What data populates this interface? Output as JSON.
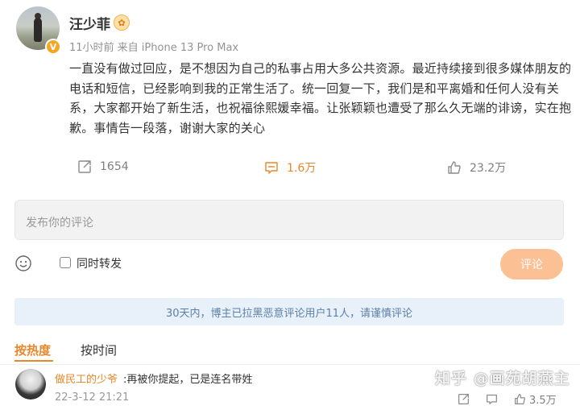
{
  "post": {
    "author": "汪少菲",
    "vip_badge": "✿",
    "meta": "11小时前 来自 iPhone 13 Pro Max",
    "text": "一直没有做过回应，是不想因为自己的私事占用大多公共资源。最近持续接到很多媒体朋友的电话和短信，已经影响到我的正常生活了。统一回复一下，我们是和平离婚和任何人没有关系，大家都开始了新生活，也祝福徐熙媛幸福。让张颖颖也遭受了那么久无端的诽谤，实在抱歉。事情告一段落，谢谢大家的关心"
  },
  "actions": {
    "repost_count": "1654",
    "comment_count": "1.6万",
    "like_count": "23.2万"
  },
  "comment_input": {
    "placeholder": "发布你的评论",
    "also_repost_label": "同时转发",
    "submit_label": "评论"
  },
  "notice": "30天内，博主已拉黑恶意评论用户11人，请谨慎评论",
  "tabs": {
    "hot": "按热度",
    "time": "按时间"
  },
  "comments": [
    {
      "author": "做民工的少爷",
      "text": ":再被你提起，已是连名带姓",
      "time": "22-3-12 21:21",
      "likes": "3.5万"
    }
  ],
  "watermark": "知乎 @画苑胡燕主",
  "colors": {
    "accent": "#e8872a",
    "notice_bg": "#e8f1fa",
    "submit_bg": "#fbc195"
  }
}
